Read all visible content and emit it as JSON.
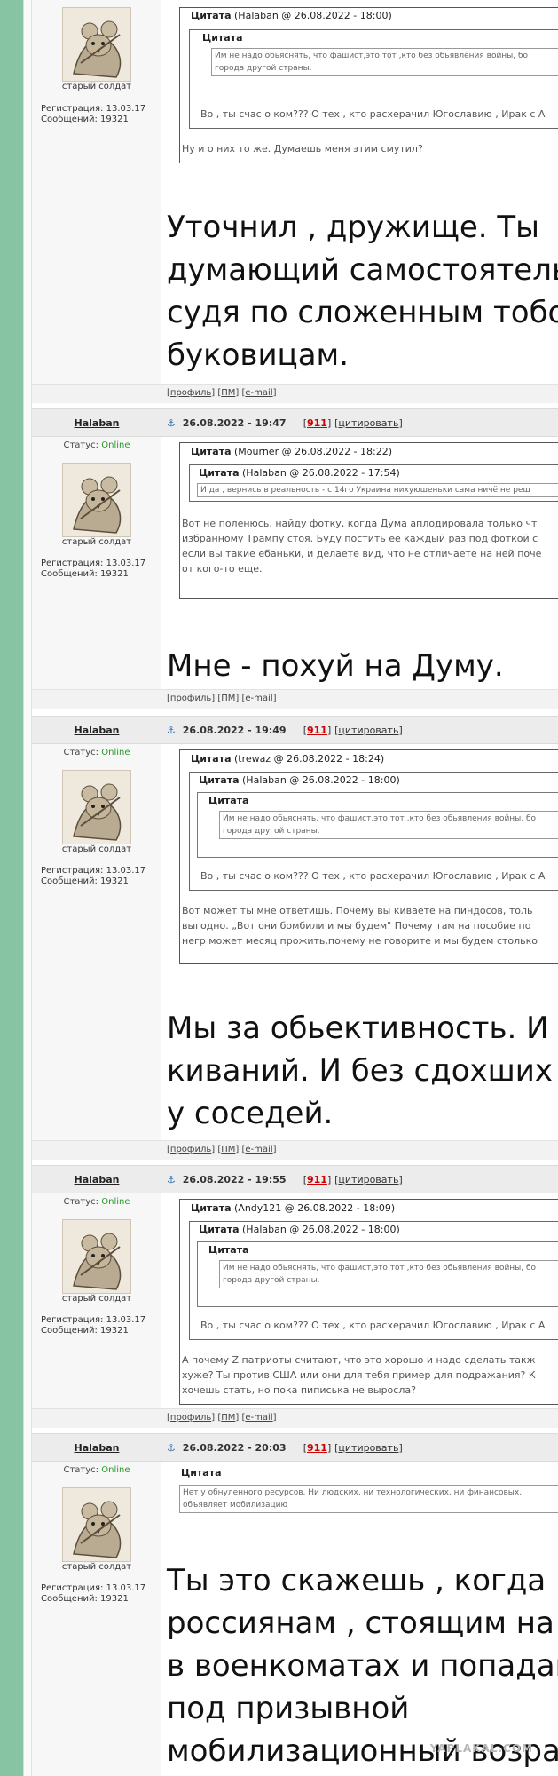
{
  "theme": {
    "accent_green": "#86c4a4",
    "online_color": "#2a9a2a",
    "post_number_color": "#cc0000"
  },
  "user": {
    "name": "Halaban",
    "status_label": "Статус:",
    "status_value": "Online",
    "rank": "старый солдат",
    "reg": "Регистрация: 13.03.17",
    "msgs": "Сообщений: 19321",
    "avatar_icon": "rat-soldier-avatar"
  },
  "footer_links": {
    "lb": "[",
    "rb": "]",
    "profile": "профиль",
    "pm": "ПМ",
    "email": "e-mail"
  },
  "post_actions": {
    "quote": "цитировать",
    "anchor_icon": "anchor-icon"
  },
  "posts": [
    {
      "quote_label": "Цитата",
      "quote_author": "(Halaban @ 26.08.2022 - 18:00)",
      "inner_label": "Цитата",
      "inner_text_1": "Им не надо обьяснять, что фашист,это тот ,кто без обьявления войны, бо",
      "inner_text_2": "города другой страны.",
      "quote_line_1": "Во , ты счас о ком??? О тех , кто расхерачил Югославию , Ирак с А",
      "outer_line_1": "Ну и о них то же. Думаешь меня этим смутил?",
      "reply_1": "Уточнил , дружище. Ты",
      "reply_2": "думающий самостоятель",
      "reply_3": "судя по сложенным тобо",
      "reply_4": "буковицам."
    },
    {
      "date": "26.08.2022 - 19:47",
      "num": "911",
      "quote_label": "Цитата",
      "quote_author": "(Mourner @ 26.08.2022 - 18:22)",
      "inner_label": "Цитата",
      "inner_author": "(Halaban @ 26.08.2022 - 17:54)",
      "inner_text_1": "И да , вернись в реальность - с 14го Украина нихуюшеньки сама ничё не реш",
      "line_1": "Вот не поленюсь, найду фотку, когда Дума аплодировала только чт",
      "line_2": "избранному Трампу стоя. Буду постить её каждый раз под фоткой с",
      "line_3": "если вы такие ебаньки, и делаете вид, что не отличаете на ней поче",
      "line_4": "от кого-то еще.",
      "reply_1": "Мне - похуй на Думу."
    },
    {
      "date": "26.08.2022 - 19:49",
      "num": "911",
      "quote_label": "Цитата",
      "quote_author": "(trewaz @ 26.08.2022 - 18:24)",
      "mid_label": "Цитата",
      "mid_author": "(Halaban @ 26.08.2022 - 18:00)",
      "inner_label": "Цитата",
      "inner_text_1": "Им не надо обьяснять, что фашист,это тот ,кто без обьявления войны, бо",
      "inner_text_2": "города другой страны.",
      "mid_line_1": "Во , ты счас о ком??? О тех , кто расхерачил Югославию , Ирак с А",
      "line_1": "Вот может ты мне ответишь. Почему вы киваете на пиндосов, толь",
      "line_2": "выгодно. „Вот они бомбили и мы будем\" Почему там на пособие по",
      "line_3": "негр может месяц прожить,почему не говорите и мы будем столько",
      "reply_1": "Мы за обьективность. И",
      "reply_2": "киваний. И без сдохших",
      "reply_3": "у соседей."
    },
    {
      "date": "26.08.2022 - 19:55",
      "num": "911",
      "quote_label": "Цитата",
      "quote_author": "(Andy121 @ 26.08.2022 - 18:09)",
      "mid_label": "Цитата",
      "mid_author": "(Halaban @ 26.08.2022 - 18:00)",
      "inner_label": "Цитата",
      "inner_text_1": "Им не надо обьяснять, что фашист,это тот ,кто без обьявления войны, бо",
      "inner_text_2": "города другой страны.",
      "mid_line_1": "Во , ты счас о ком??? О тех , кто расхерачил Югославию , Ирак с А",
      "line_1": "А почему Z патриоты считают, что это хорошо и надо сделать такж",
      "line_2": "хуже? Ты против США или они для тебя пример для подражания? К",
      "line_3": "хочешь стать, но пока пиписька не выросла?"
    },
    {
      "date": "26.08.2022 - 20:03",
      "num": "911",
      "quote_label": "Цитата",
      "inner_text_1": "Нет у обнуленного ресурсов. Ни людских, ни технологических, ни финансовых.",
      "inner_text_2": "объявляет мобилизацию",
      "reply_1": "Ты это скажешь , когда",
      "reply_2": "россиянам , стоящим на",
      "reply_3": "в военкоматах и попадан",
      "reply_4": "под призывной",
      "reply_5": "мобилизационный возра"
    }
  ],
  "watermark": "YAPLAKAL.COM"
}
